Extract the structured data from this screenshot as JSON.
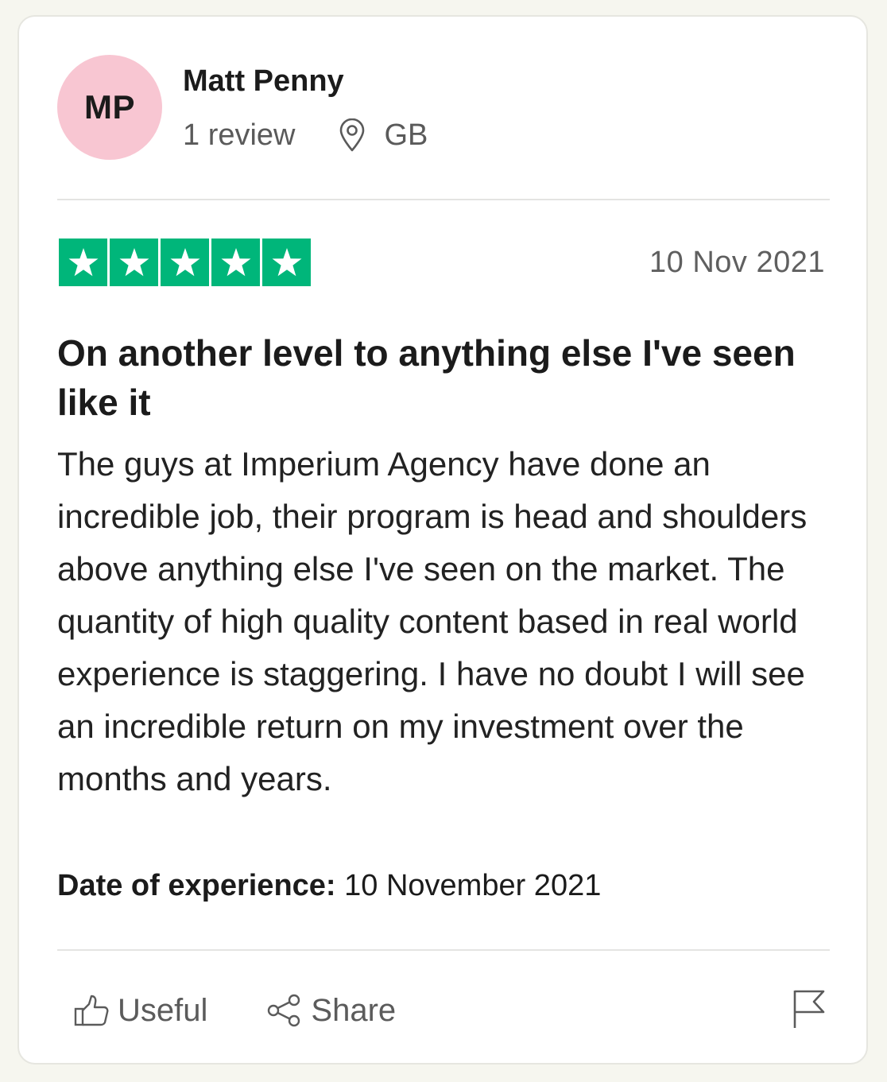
{
  "reviewer": {
    "initials": "MP",
    "name": "Matt Penny",
    "review_count": "1 review",
    "location": "GB",
    "avatar_color": "#f8c6d2"
  },
  "review": {
    "rating": 5,
    "rating_max": 5,
    "star_color": "#00b67a",
    "date": "10 Nov 2021",
    "title": "On another level to anything else I've seen like it",
    "body": "The guys at Imperium Agency have done an incredible job, their program is head and shoulders above anything else I've seen on the market. The quantity of high quality content based in real world experience is staggering. I have no doubt I will see an incredible return on my investment over the months and years.",
    "experience_label": "Date of experience:",
    "experience_date": "10 November 2021"
  },
  "actions": {
    "useful_label": "Useful",
    "share_label": "Share",
    "useful_icon": "thumbs-up-icon",
    "share_icon": "share-icon",
    "flag_icon": "flag-icon"
  }
}
